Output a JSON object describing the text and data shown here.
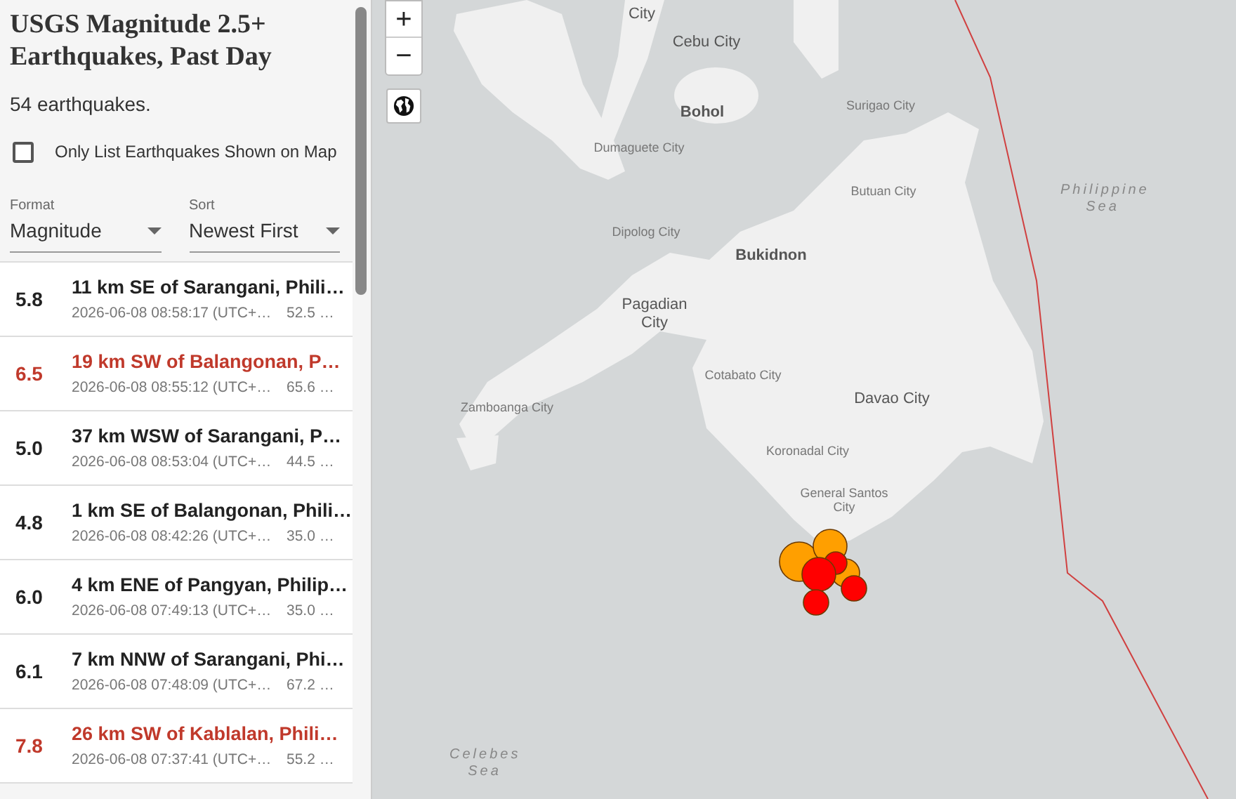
{
  "sidebar": {
    "title": "USGS Magnitude 2.5+ Earthquakes, Past Day",
    "count": "54 earthquakes.",
    "filter": {
      "label": "Only List Earthquakes Shown on Map",
      "checked": false
    },
    "selects": [
      {
        "label": "Format",
        "value": "Magnitude"
      },
      {
        "label": "Sort",
        "value": "Newest First"
      }
    ],
    "rows": [
      {
        "mag": "5.8",
        "place": "11 km SE of Sarangani, Phili…",
        "time": "2026-06-08 08:58:17 (UTC+…",
        "depth": "52.5 …",
        "alert": false
      },
      {
        "mag": "6.5",
        "place": "19 km SW of Balangonan, P…",
        "time": "2026-06-08 08:55:12 (UTC+…",
        "depth": "65.6 …",
        "alert": true
      },
      {
        "mag": "5.0",
        "place": "37 km WSW of Sarangani, P…",
        "time": "2026-06-08 08:53:04 (UTC+…",
        "depth": "44.5 …",
        "alert": false
      },
      {
        "mag": "4.8",
        "place": "1 km SE of Balangonan, Phili…",
        "time": "2026-06-08 08:42:26 (UTC+…",
        "depth": "35.0 …",
        "alert": false
      },
      {
        "mag": "6.0",
        "place": "4 km ENE of Pangyan, Philip…",
        "time": "2026-06-08 07:49:13 (UTC+…",
        "depth": "35.0 …",
        "alert": false
      },
      {
        "mag": "6.1",
        "place": "7 km NNW of Sarangani, Phi…",
        "time": "2026-06-08 07:48:09 (UTC+…",
        "depth": "67.2 …",
        "alert": false
      },
      {
        "mag": "7.8",
        "place": "26 km SW of Kablalan, Phili…",
        "time": "2026-06-08 07:37:41 (UTC+…",
        "depth": "55.2 …",
        "alert": true
      }
    ]
  },
  "map": {
    "zoom_in": "+",
    "zoom_out": "−",
    "labels": [
      {
        "kind": "city",
        "text": "City"
      },
      {
        "kind": "city",
        "text": "Cebu City"
      },
      {
        "kind": "region",
        "text": "Bohol"
      },
      {
        "kind": "small",
        "text": "Surigao City"
      },
      {
        "kind": "small",
        "text": "Dumaguete City"
      },
      {
        "kind": "small",
        "text": "Butuan City"
      },
      {
        "kind": "sea",
        "text": "Philippine Sea"
      },
      {
        "kind": "small",
        "text": "Dipolog City"
      },
      {
        "kind": "region",
        "text": "Bukidnon"
      },
      {
        "kind": "city",
        "text": "Pagadian City"
      },
      {
        "kind": "small",
        "text": "Cotabato City"
      },
      {
        "kind": "small",
        "text": "Zamboanga City"
      },
      {
        "kind": "city",
        "text": "Davao City"
      },
      {
        "kind": "small",
        "text": "Koronadal City"
      },
      {
        "kind": "small",
        "text": "General Santos City"
      },
      {
        "kind": "sea",
        "text": "Celebes Sea"
      }
    ],
    "quakes": [
      {
        "color": "#ff9f00"
      },
      {
        "color": "#ff9f00"
      },
      {
        "color": "#ff9f00"
      },
      {
        "color": "#ff0000"
      },
      {
        "color": "#ff0000"
      },
      {
        "color": "#ff0000"
      },
      {
        "color": "#ff0000"
      }
    ]
  }
}
